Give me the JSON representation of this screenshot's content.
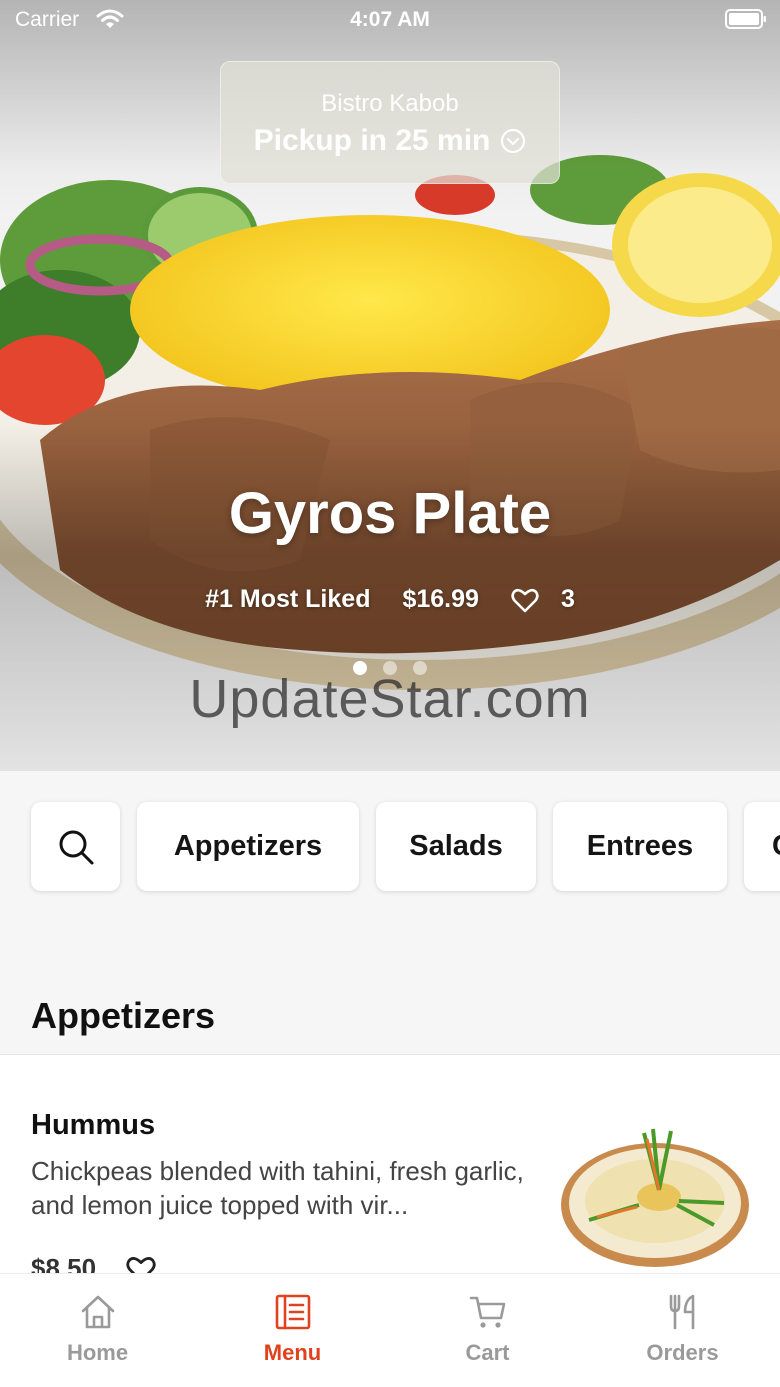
{
  "status_bar": {
    "carrier": "Carrier",
    "time": "4:07 AM"
  },
  "pickup": {
    "restaurant": "Bistro Kabob",
    "time": "Pickup in 25 min"
  },
  "hero": {
    "title": "Gyros Plate",
    "badge": "#1 Most Liked",
    "price": "$16.99",
    "likes": "3",
    "slide_count": 3,
    "active_slide": 1
  },
  "watermark": "UpdateStar.com",
  "categories": {
    "search_icon": "search-icon",
    "items": [
      "Appetizers",
      "Salads",
      "Entrees",
      "C"
    ]
  },
  "section": {
    "title": "Appetizers"
  },
  "menu_item": {
    "name": "Hummus",
    "description": "Chickpeas blended with tahini, fresh garlic, and lemon juice topped with vir...",
    "price": "$8.50"
  },
  "tabs": [
    {
      "label": "Home",
      "icon": "home-icon"
    },
    {
      "label": "Menu",
      "icon": "menu-icon",
      "active": true
    },
    {
      "label": "Cart",
      "icon": "cart-icon"
    },
    {
      "label": "Orders",
      "icon": "utensils-icon"
    }
  ],
  "colors": {
    "accent": "#e0421e",
    "inactive_tab": "#9a9a9a"
  }
}
